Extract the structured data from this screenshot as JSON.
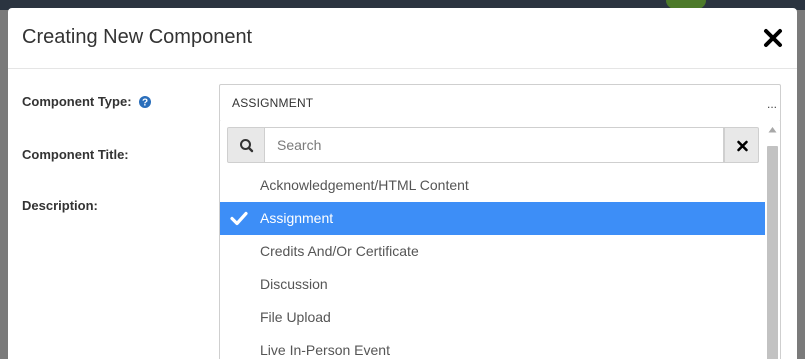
{
  "modal": {
    "title": "Creating New Component"
  },
  "form": {
    "component_type_label": "Component Type:",
    "component_title_label": "Component Title:",
    "description_label": "Description:"
  },
  "select": {
    "value": "ASSIGNMENT",
    "dots": "..."
  },
  "search": {
    "placeholder": "Search"
  },
  "options": [
    {
      "label": "Acknowledgement/HTML Content",
      "selected": false
    },
    {
      "label": "Assignment",
      "selected": true
    },
    {
      "label": "Credits And/Or Certificate",
      "selected": false
    },
    {
      "label": "Discussion",
      "selected": false
    },
    {
      "label": "File Upload",
      "selected": false
    },
    {
      "label": "Live In-Person Event",
      "selected": false
    }
  ],
  "colors": {
    "accent": "#3d8ef7",
    "help_icon": "#2a6ebb"
  },
  "icons": {
    "close": "close-icon",
    "help": "question-circle-icon",
    "search": "search-icon",
    "clear": "clear-icon",
    "check": "check-icon"
  }
}
